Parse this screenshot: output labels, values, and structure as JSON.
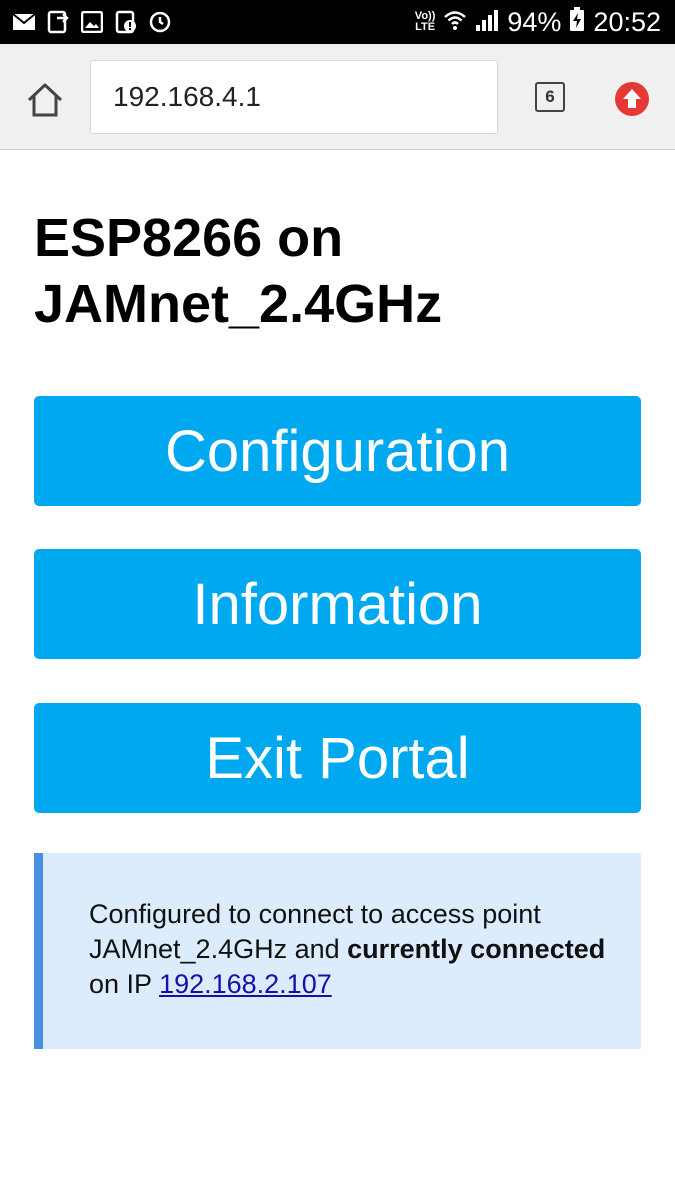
{
  "status_bar": {
    "battery": "94%",
    "time": "20:52",
    "network": [
      "Vo))",
      "LTE"
    ]
  },
  "browser": {
    "url": "192.168.4.1",
    "tab_count": "6"
  },
  "page": {
    "title": "ESP8266 on JAMnet_2.4GHz",
    "buttons": [
      "Configuration",
      "Information",
      "Exit Portal"
    ]
  },
  "info": {
    "text_1": "Configured to connect to access point JAMnet_2.4GHz and ",
    "bold_1": "currently connected",
    "text_2": " on IP ",
    "link": "192.168.2.107"
  },
  "colors": {
    "button": "#00a8ef",
    "info_bg": "#dcecfc",
    "info_border": "#4a90e2"
  }
}
